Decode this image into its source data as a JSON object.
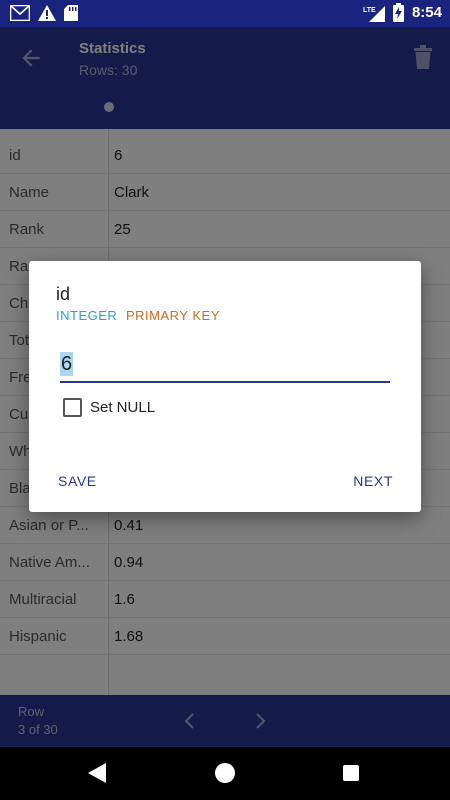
{
  "status_bar": {
    "time": "8:54",
    "network": "LTE"
  },
  "app_bar": {
    "title": "Statistics",
    "subtitle": "Rows: 30"
  },
  "table": {
    "rows": [
      {
        "key": "id",
        "value": "6"
      },
      {
        "key": "Name",
        "value": "Clark"
      },
      {
        "key": "Rank",
        "value": "25"
      },
      {
        "key": "Ra",
        "value": ""
      },
      {
        "key": "Ch",
        "value": ""
      },
      {
        "key": "Tot",
        "value": ""
      },
      {
        "key": "Fre",
        "value": ""
      },
      {
        "key": "Cu",
        "value": ""
      },
      {
        "key": "Wh",
        "value": ""
      },
      {
        "key": "Bla",
        "value": ""
      },
      {
        "key": "Asian or P...",
        "value": "0.41"
      },
      {
        "key": "Native Am...",
        "value": "0.94"
      },
      {
        "key": "Multiracial",
        "value": "1.6"
      },
      {
        "key": "Hispanic",
        "value": "1.68"
      }
    ]
  },
  "bottom_bar": {
    "label": "Row",
    "position": "3 of 30"
  },
  "dialog": {
    "title": "id",
    "type": "INTEGER",
    "constraint": "PRIMARY KEY",
    "input_value": "6",
    "set_null_label": "Set NULL",
    "set_null_checked": false,
    "save_label": "SAVE",
    "next_label": "NEXT"
  },
  "colors": {
    "primary": "#283593",
    "primary_dark": "#1a237e",
    "type_color": "#22a6c8",
    "constraint_color": "#d2691e"
  }
}
